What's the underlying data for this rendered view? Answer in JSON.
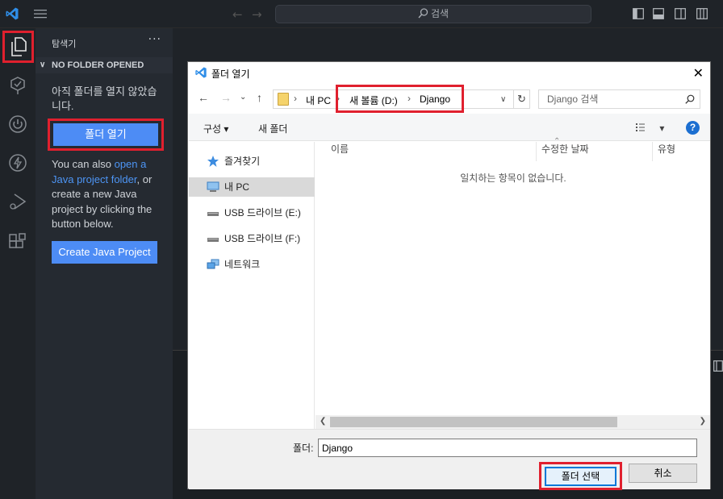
{
  "titlebar": {
    "logo_icon": "vscode-logo-icon",
    "menu_icon": "hamburger-menu-icon",
    "back_icon": "arrow-left-icon",
    "forward_icon": "arrow-right-icon",
    "search_label": "검색",
    "layout_icons": [
      "layout-sidebar-left-icon",
      "layout-panel-icon",
      "layout-sidebar-right-icon",
      "customize-layout-icon"
    ]
  },
  "activitybar": {
    "items": [
      "explorer-icon",
      "testing-icon",
      "power-icon",
      "lightning-icon",
      "run-debug-icon",
      "extensions-icon"
    ]
  },
  "sidebar": {
    "title": "탐색기",
    "more": "···",
    "section": "NO FOLDER OPENED",
    "message": "아직 폴더를 열지 않았습니다.",
    "open_folder_button": "폴더 열기",
    "hint_prefix": "You can also ",
    "hint_link": "open a Java project folder",
    "hint_suffix": ", or create a new Java project by clicking the button below.",
    "create_java_button": "Create Java Project"
  },
  "dialog": {
    "title": "폴더 열기",
    "close": "✕",
    "back": "←",
    "forward": "→",
    "recent": "⌄",
    "up": "↑",
    "address": {
      "parts": [
        "내 PC",
        "새 볼륨 (D:)",
        "Django"
      ]
    },
    "refresh": "↻",
    "search_placeholder": "Django 검색",
    "toolbar": {
      "organize": "구성 ▾",
      "new_folder": "새 폴더",
      "view": "▾",
      "help": "?"
    },
    "nav_items": [
      {
        "label": "즐겨찾기",
        "icon": "star-icon"
      },
      {
        "label": "내 PC",
        "icon": "computer-icon"
      },
      {
        "label": "USB 드라이브 (E:)",
        "icon": "usb-drive-icon"
      },
      {
        "label": "USB 드라이브 (F:)",
        "icon": "usb-drive-icon"
      },
      {
        "label": "네트워크",
        "icon": "network-icon"
      }
    ],
    "columns": [
      "이름",
      "수정한 날짜",
      "유형"
    ],
    "empty_message": "일치하는 항목이 없습니다.",
    "folder_label": "폴더:",
    "folder_value": "Django",
    "select_button": "폴더 선택",
    "cancel_button": "취소"
  },
  "colors": {
    "accent_blue": "#4d8cf5",
    "highlight_red": "#e0202e",
    "dialog_primary": "#0078d7"
  }
}
